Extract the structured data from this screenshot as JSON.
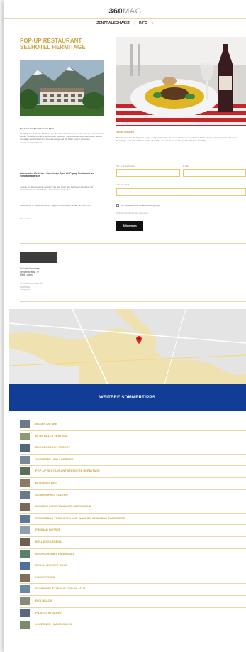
{
  "header": {
    "logo_bold": "360",
    "logo_light": "MAG"
  },
  "nav": {
    "items": [
      "ZENTRALSCHWEIZ",
      "INFO"
    ],
    "separator": "|",
    "search_glyph": "⌕"
  },
  "article": {
    "title": "POP-UP RESTAURANT SEEHOTEL HERMITAGE",
    "lead": "Das Haus am See mit neuen Stars",
    "paragraph1": "Ab Pfingsten bis Ende Juli bietet das Seehotel Hermitage mit seinem Pop-up Restaurant auf der Terrasse kulinarische Genüsse direkt am Vierwaldstättersee. Geniessen Sie die einmalige Aussicht auf den See, die Berge und die Stadt Luzern bei einem unvergesslichen Abend.",
    "subhead": "Kulinarische Weltreise – Das einzige Open Air Pop-up Restaurant am Vierwaldstättersee",
    "paragraph2": "Jeweils am Wochenende verwöhnt Sie das Team des Seehotel Hermitage mit internationalen Köstlichkeiten. Reservation empfohlen.",
    "paragraph3": "Geöffnet bis 1. September 2018. Täglich bei schönem Wetter, ab 18:00 Uhr.",
    "more_link": "Mehr erfahren"
  },
  "contest": {
    "title": "VERLOSUNG",
    "text": "Beantworten Sie die folgende Frage und gewinnen Sie mit etwas Glück einen Gutschein für das Pop-up Restaurant am Seehotel Hermitage. Teilnahmeschluss ist der 29.7.2018. Die Gewinner werden per E-Mail benachrichtigt.",
    "label_first": "Vor- und Nachname",
    "label_second": "E-Mail",
    "label_third": "Adresse, PLZ",
    "checkbox_label": "Ich akzeptiere die Teilnahmebedingungen",
    "conditions_link": "Teilnahmebedingungen Verlosung",
    "submit_label": "Teilnehmen"
  },
  "address": {
    "name": "Seehotel Hermitage",
    "street": "Seeburgstrasse 72",
    "city": "6006 Luzern",
    "links": [
      "Seehotel-hermitage.ch",
      "Facebook",
      "Instagram"
    ]
  },
  "map": {
    "pin_color": "#d9262c",
    "water_color": "#f0e1b0",
    "land_color": "#e3e3e3"
  },
  "section": {
    "banner_title": "WEITERE SOMMERTIPPS",
    "banner_color": "#113d96"
  },
  "tips": [
    "BADEN AM SEE",
    "BLUE BALLS FESTIVAL",
    "BÜRGENSTOCK RESORT",
    "ZUGERSEE UND ÄGERISEE",
    "POP-UP RESTAURANT SEEHOTEL HERMITAGE",
    "BUBI'S BISTRO",
    "SOMMERFEST LUZERN",
    "SUMMER IN RESTAURANT OBERGRUND",
    "STRANDBAD TRIBSCHEN UND WALDSCHWIMMBAD ZIMMEREGG",
    "FREIBAD ROTSEE",
    "BELLINI GARDENS",
    "BRUNCHEN MIT PANORAMA",
    "BEACH BURGER BOAT",
    "KINO ROTSEE",
    "SOMMERPLÄTZE AUF DEM PILATUS",
    "RIGI BEACH",
    "PILATUS IN NACHT",
    "LUZERNER HIMMELSKINO"
  ]
}
